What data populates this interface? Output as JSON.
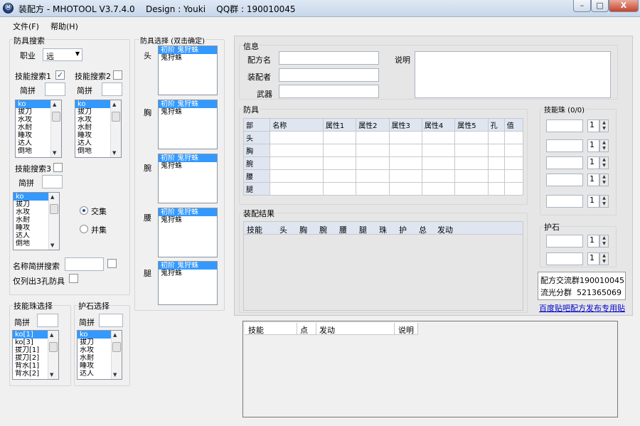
{
  "window": {
    "title": "装配方 - MHOTOOL V3.7.4.0    Design : Youki    QQ群 : 190010045",
    "icon_glyph": "Ⓜ",
    "buttons": {
      "minimize": "–",
      "maximize": "□",
      "close": "X"
    }
  },
  "menu": {
    "items": [
      "文件(F)",
      "帮助(H)"
    ]
  },
  "armor_search": {
    "title": "防具搜索",
    "job_label": "职业",
    "job_value": "远",
    "skill1": {
      "label": "技能搜索1",
      "checked": "✓",
      "filter_label": "简拼",
      "filter_value": ""
    },
    "skill2": {
      "label": "技能搜索2",
      "checked": "",
      "filter_label": "简拼",
      "filter_value": ""
    },
    "skill3": {
      "label": "技能搜索3",
      "checked": "",
      "filter_label": "简拼",
      "filter_value": ""
    },
    "skill_list": [
      "ko",
      "拔刀",
      "水攻",
      "水耐",
      "睡攻",
      "达人",
      "倒地"
    ],
    "intersect_label": "交集",
    "union_label": "并集",
    "name_search_label": "名称简拼搜索",
    "name_search_value": "",
    "only3slot_label": "仅列出3孔防具"
  },
  "armor_select": {
    "title": "防具选择 (双击确定)",
    "parts": [
      {
        "label": "头",
        "items": [
          "初阶 鬼狩蛛",
          "鬼狩蛛"
        ]
      },
      {
        "label": "胸",
        "items": [
          "初阶 鬼狩蛛",
          "鬼狩蛛"
        ]
      },
      {
        "label": "腕",
        "items": [
          "初阶 鬼狩蛛",
          "鬼狩蛛"
        ]
      },
      {
        "label": "腰",
        "items": [
          "初阶 鬼狩蛛",
          "鬼狩蛛"
        ]
      },
      {
        "label": "腿",
        "items": [
          "初阶 鬼狩蛛",
          "鬼狩蛛"
        ]
      }
    ]
  },
  "jewel_select": {
    "title": "技能珠选择",
    "filter_label": "简拼",
    "filter_value": "",
    "items": [
      "ko[1]",
      "ko[3]",
      "拔刀[1]",
      "拔刀[2]",
      "背水[1]",
      "背水[2]"
    ]
  },
  "stone_select": {
    "title": "护石选择",
    "filter_label": "简拼",
    "filter_value": "",
    "items": [
      "ko",
      "拔刀",
      "水攻",
      "水耐",
      "睡攻",
      "达人"
    ]
  },
  "info": {
    "title": "信息",
    "name_label": "配方名",
    "name_value": "",
    "author_label": "装配者",
    "author_value": "",
    "weapon_label": "武器",
    "weapon_value": "",
    "desc_label": "说明",
    "desc_value": ""
  },
  "armor_table": {
    "title": "防具",
    "headers": [
      "部",
      "名称",
      "属性1",
      "属性2",
      "属性3",
      "属性4",
      "属性5",
      "孔",
      "值"
    ],
    "rows": [
      "头",
      "胸",
      "腕",
      "腰",
      "腿"
    ]
  },
  "jewels": {
    "title": "技能珠 (0/0)",
    "rows": [
      {
        "value": "",
        "qty": "1"
      },
      {
        "value": "",
        "qty": "1"
      },
      {
        "value": "",
        "qty": "1"
      },
      {
        "value": "",
        "qty": "1"
      },
      {
        "value": "",
        "qty": "1"
      }
    ]
  },
  "result": {
    "title": "装配结果",
    "headers": [
      "技能",
      "头",
      "胸",
      "腕",
      "腰",
      "腿",
      "珠",
      "护",
      "总",
      "发动"
    ]
  },
  "stones": {
    "title": "护石",
    "rows": [
      {
        "value": "",
        "qty": "1"
      },
      {
        "value": "",
        "qty": "1"
      }
    ]
  },
  "groups_info": {
    "line1": "配方交流群190010045",
    "line2": "流光分群  521365069"
  },
  "tieba_link": "百度贴吧配方发布专用贴",
  "bottom_table": {
    "headers": [
      "技能",
      "点",
      "发动",
      "说明"
    ]
  }
}
